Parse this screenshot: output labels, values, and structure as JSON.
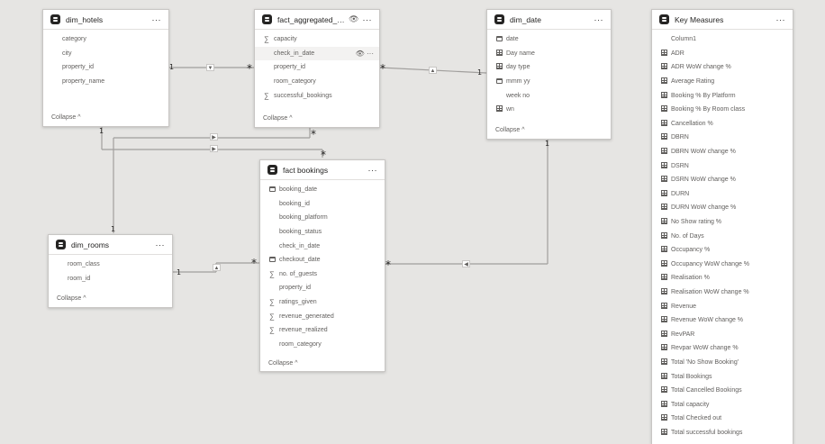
{
  "tables": {
    "dim_hotels": {
      "title": "dim_hotels",
      "fields": [
        "category",
        "city",
        "property_id",
        "property_name"
      ],
      "collapse": "Collapse"
    },
    "fact_aggregated": {
      "title": "fact_aggregated_b...",
      "fields": [
        "capacity",
        "check_in_date",
        "property_id",
        "room_category",
        "successful_bookings"
      ],
      "collapse": "Collapse"
    },
    "dim_date": {
      "title": "dim_date",
      "fields": [
        "date",
        "Day name",
        "day type",
        "mmm yy",
        "week no",
        "wn"
      ],
      "collapse": "Collapse"
    },
    "dim_rooms": {
      "title": "dim_rooms",
      "fields": [
        "room_class",
        "room_id"
      ],
      "collapse": "Collapse"
    },
    "fact_bookings": {
      "title": "fact bookings",
      "fields": [
        "booking_date",
        "booking_id",
        "booking_platform",
        "booking_status",
        "check_in_date",
        "checkout_date",
        "no. of_guests",
        "property_id",
        "ratings_given",
        "revenue_generated",
        "revenue_realized",
        "room_category"
      ],
      "collapse": "Collapse"
    },
    "key_measures": {
      "title": "Key Measures",
      "fields": [
        "Column1",
        "ADR",
        "ADR WoW change %",
        "Average Rating",
        "Booking % By Platform",
        "Booking % By Room class",
        "Cancellation %",
        "DBRN",
        "DBRN WoW change %",
        "DSRN",
        "DSRN WoW change %",
        "DURN",
        "DURN WoW change %",
        "No Show rating %",
        "No. of Days",
        "Occupancy %",
        "Occupancy WoW change %",
        "Realisation %",
        "Realisation WoW change %",
        "Revenue",
        "Revenue WoW change %",
        "RevPAR",
        "Revpar WoW change %",
        "Total 'No Show Booking'",
        "Total Bookings",
        "Total Cancelled Bookings",
        "Total capacity",
        "Total Checked out",
        "Total successful bookings"
      ]
    }
  },
  "icons": {
    "table": "table-icon",
    "more": "more-options-icon",
    "eye": "eye-icon",
    "sigma": "sum-icon",
    "calendar": "calendar-icon",
    "measure": "measure-icon",
    "chevron_up": "chevron-up-icon"
  },
  "glyphs": {
    "more": "···",
    "eye": "👁",
    "sigma": "∑",
    "up": "^",
    "one": "1",
    "many": "*",
    "tri_down": "▼",
    "tri_up": "▲",
    "tri_right": "▶",
    "tri_left": "◀"
  },
  "colors": {
    "canvas": "#e6e5e3",
    "card": "#ffffff",
    "line": "#a19f9d",
    "text": "#252423",
    "muted": "#605e5c"
  }
}
